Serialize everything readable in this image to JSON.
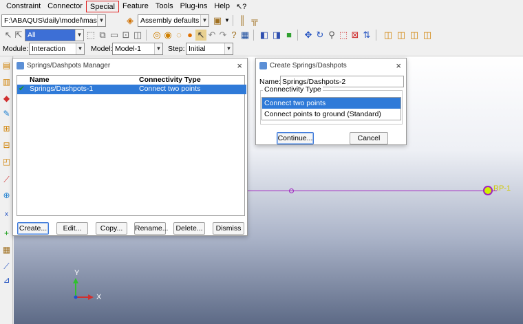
{
  "menubar": {
    "items": [
      "Constraint",
      "Connector",
      "Special",
      "Feature",
      "Tools",
      "Plug-ins",
      "Help"
    ],
    "highlighted": "Special",
    "help_icon": "↖?"
  },
  "toolbar1": {
    "path_value": "F:\\ABAQUS\\daily\\model\\mass_f",
    "assembly_defaults": "Assembly defaults"
  },
  "toolbar2": {
    "filter_value": "All"
  },
  "modbar": {
    "module_label": "Module:",
    "module_value": "Interaction",
    "model_label": "Model:",
    "model_value": "Model-1",
    "step_label": "Step:",
    "step_value": "Initial"
  },
  "viewport": {
    "rp_label": "RP-1",
    "axis_y": "Y",
    "axis_x": "X"
  },
  "manager": {
    "title": "Springs/Dashpots Manager",
    "close": "×",
    "col_name": "Name",
    "col_type": "Connectivity Type",
    "rows": [
      {
        "check": "✔",
        "name": "Springs/Dashpots-1",
        "type": "Connect two points"
      }
    ],
    "buttons": {
      "create": "Create...",
      "edit": "Edit...",
      "copy": "Copy...",
      "rename": "Rename...",
      "delete": "Delete...",
      "dismiss": "Dismiss"
    }
  },
  "create_dialog": {
    "title": "Create Springs/Dashpots",
    "close": "×",
    "name_label": "Name:",
    "name_value": "Springs/Dashpots-2",
    "group_label": "Connectivity Type",
    "options": [
      "Connect two points",
      "Connect points to ground (Standard)"
    ],
    "selected": "Connect two points",
    "continue": "Continue...",
    "cancel": "Cancel"
  },
  "colors": {
    "accent": "#2f7ad8",
    "highlight_box": "#e02020",
    "wire": "#a020c0",
    "rp_marker": "#d0f000"
  }
}
